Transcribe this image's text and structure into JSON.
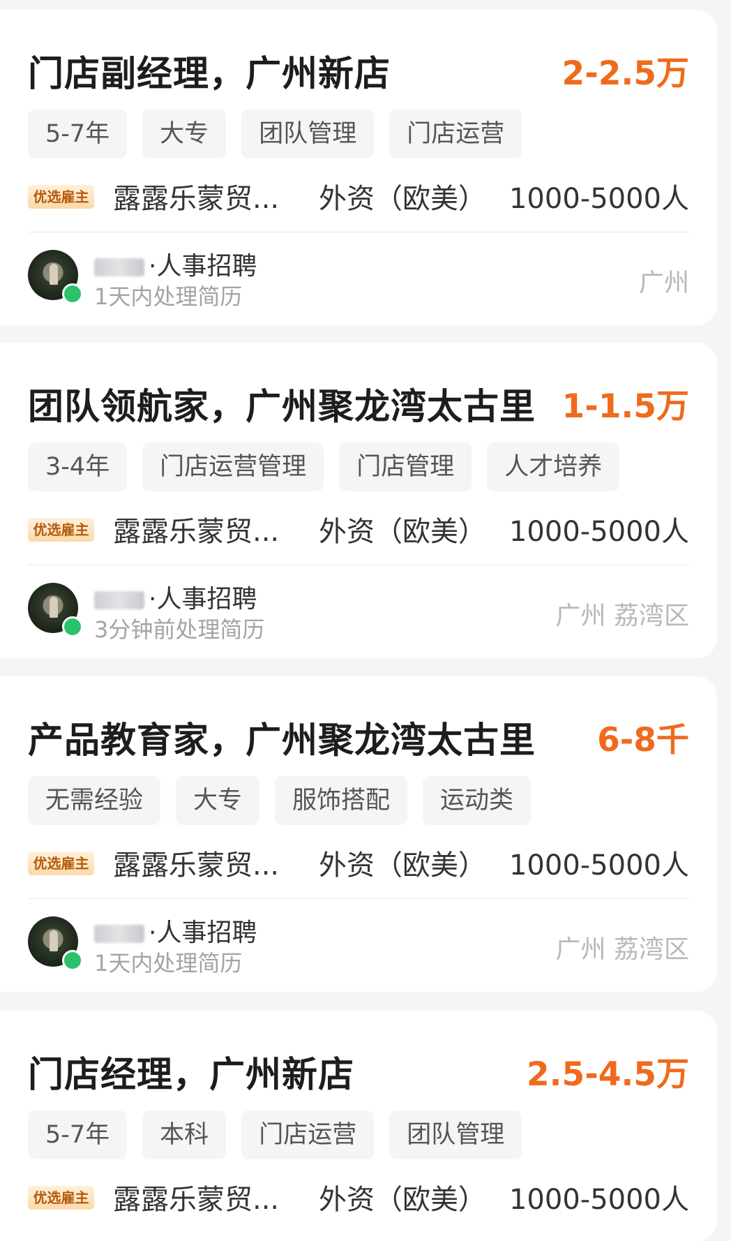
{
  "jobs": [
    {
      "title": "门店副经理，广州新店",
      "salary": "2-2.5万",
      "tags": [
        "5-7年",
        "大专",
        "团队管理",
        "门店运营"
      ],
      "badge": "优选雇主",
      "company_name": "露露乐蒙贸...",
      "company_type": "外资（欧美）",
      "company_size": "1000-5000人",
      "recruiter_title": "·人事招聘",
      "response_time": "1天内处理简历",
      "location": "广州"
    },
    {
      "title": "团队领航家，广州聚龙湾太古里",
      "salary": "1-1.5万",
      "tags": [
        "3-4年",
        "门店运营管理",
        "门店管理",
        "人才培养"
      ],
      "badge": "优选雇主",
      "company_name": "露露乐蒙贸...",
      "company_type": "外资（欧美）",
      "company_size": "1000-5000人",
      "recruiter_title": "·人事招聘",
      "response_time": "3分钟前处理简历",
      "location": "广州  荔湾区"
    },
    {
      "title": "产品教育家，广州聚龙湾太古里",
      "salary": "6-8千",
      "tags": [
        "无需经验",
        "大专",
        "服饰搭配",
        "运动类"
      ],
      "badge": "优选雇主",
      "company_name": "露露乐蒙贸...",
      "company_type": "外资（欧美）",
      "company_size": "1000-5000人",
      "recruiter_title": "·人事招聘",
      "response_time": "1天内处理简历",
      "location": "广州  荔湾区"
    },
    {
      "title": "门店经理，广州新店",
      "salary": "2.5-4.5万",
      "tags": [
        "5-7年",
        "本科",
        "门店运营",
        "团队管理"
      ],
      "badge": "优选雇主",
      "company_name": "露露乐蒙贸...",
      "company_type": "外资（欧美）",
      "company_size": "1000-5000人"
    }
  ],
  "colors": {
    "salary": "#f06a1d",
    "badge_text": "#b45a0e",
    "online": "#2bc26b",
    "background": "#f4f5f7"
  }
}
